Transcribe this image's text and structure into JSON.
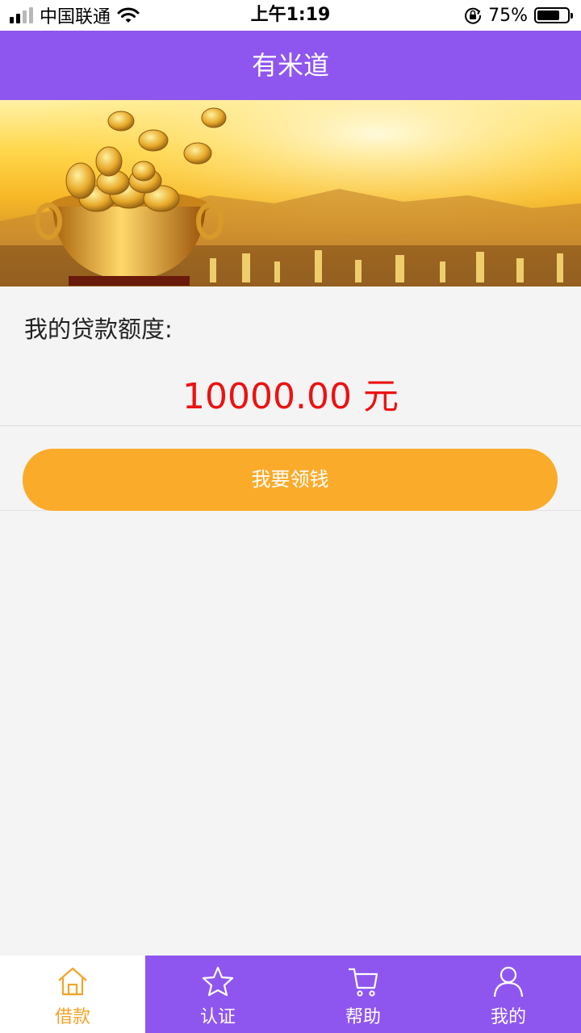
{
  "status_bar": {
    "carrier": "中国联通",
    "time": "上午1:19",
    "battery_percent": "75%",
    "battery_level": 0.75,
    "signal_bars_filled": 2,
    "signal_bars_total": 4
  },
  "header": {
    "title": "有米道"
  },
  "quota": {
    "label": "我的贷款额度:",
    "amount": "10000.00 元",
    "amount_color": "#ee1111"
  },
  "action": {
    "button_label": "我要领钱",
    "button_color": "#fbab2a"
  },
  "tab_bar": {
    "items": [
      {
        "label": "借款",
        "icon": "home-icon",
        "active": true
      },
      {
        "label": "认证",
        "icon": "star-icon",
        "active": false
      },
      {
        "label": "帮助",
        "icon": "cart-icon",
        "active": false
      },
      {
        "label": "我的",
        "icon": "user-icon",
        "active": false
      }
    ]
  },
  "colors": {
    "brand_purple": "#8f56ef",
    "active_tab_text": "#f4a329"
  }
}
